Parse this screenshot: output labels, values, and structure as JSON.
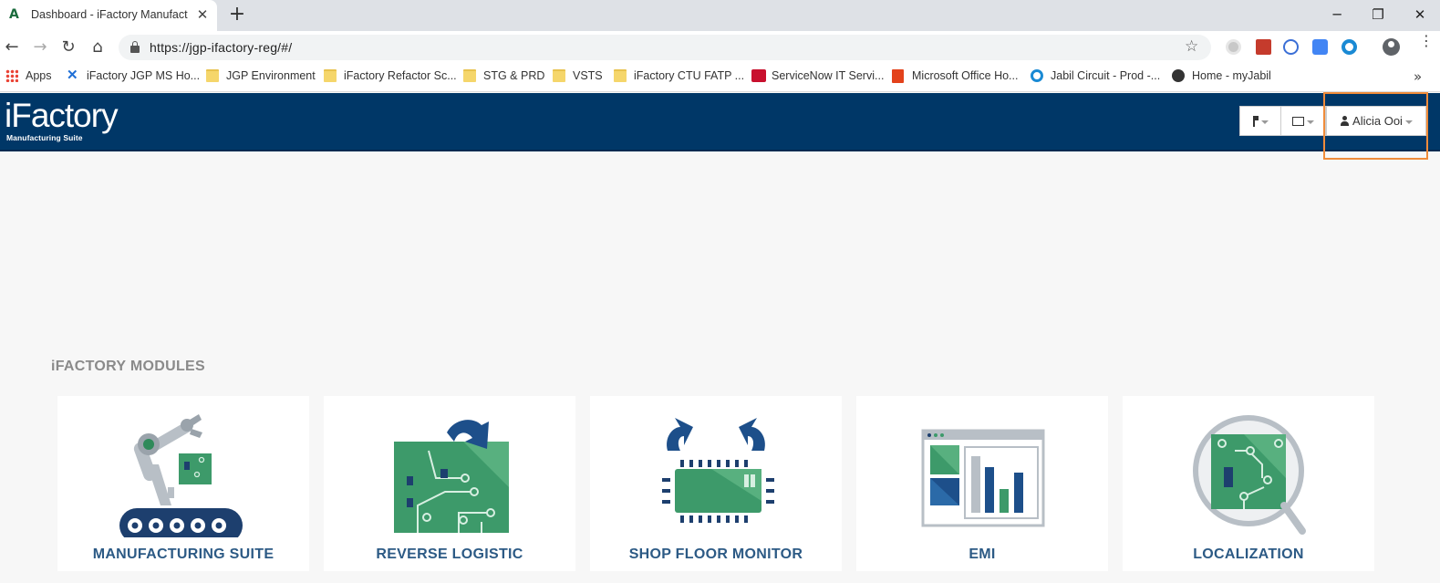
{
  "browser": {
    "tab_title": "Dashboard - iFactory Manufactur",
    "url": "https://jgp-ifactory-reg/#/",
    "bookmarks": [
      {
        "label": "Apps",
        "icon": "apps-grid-icon"
      },
      {
        "label": "iFactory JGP MS Ho...",
        "icon": "confluence-icon"
      },
      {
        "label": "JGP Environment",
        "icon": "folder-icon"
      },
      {
        "label": "iFactory Refactor Sc...",
        "icon": "folder-icon"
      },
      {
        "label": "STG & PRD",
        "icon": "folder-icon"
      },
      {
        "label": "VSTS",
        "icon": "folder-icon"
      },
      {
        "label": "iFactory CTU FATP ...",
        "icon": "folder-icon"
      },
      {
        "label": "ServiceNow IT Servi...",
        "icon": "servicenow-icon"
      },
      {
        "label": "Microsoft Office Ho...",
        "icon": "office-icon"
      },
      {
        "label": "Jabil Circuit - Prod -...",
        "icon": "jabil-icon"
      },
      {
        "label": "Home - myJabil",
        "icon": "globe-icon"
      }
    ]
  },
  "header": {
    "logo_main": "iFactory",
    "logo_sub": "Manufacturing Suite",
    "user_name": "Alicia Ooi",
    "colors": {
      "bar": "#003767",
      "highlight": "#f08c3a"
    }
  },
  "main": {
    "section_title": "iFACTORY MODULES",
    "modules": [
      {
        "label": "MANUFACTURING SUITE",
        "icon": "robot-arm-conveyor-icon"
      },
      {
        "label": "REVERSE LOGISTIC",
        "icon": "circuit-board-return-icon"
      },
      {
        "label": "SHOP FLOOR MONITOR",
        "icon": "chip-monitor-icon"
      },
      {
        "label": "EMI",
        "icon": "dashboard-chart-icon"
      },
      {
        "label": "LOCALIZATION",
        "icon": "magnifier-board-icon"
      }
    ]
  }
}
